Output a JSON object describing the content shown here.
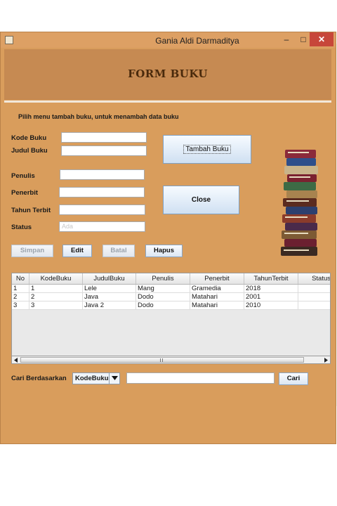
{
  "window": {
    "title": "Gania Aldi Darmaditya",
    "minimize_glyph": "–",
    "maximize_glyph": "□",
    "close_glyph": "✕"
  },
  "header": {
    "title": "FORM BUKU"
  },
  "instruction": "Pilih menu tambah buku, untuk menambah data buku",
  "form": {
    "kode_label": "Kode Buku",
    "judul_label": "Judul Buku",
    "penulis_label": "Penulis",
    "penerbit_label": "Penerbit",
    "tahun_label": "Tahun Terbit",
    "status_label": "Status",
    "kode_value": "",
    "judul_value": "",
    "penulis_value": "",
    "penerbit_value": "",
    "tahun_value": "",
    "status_placeholder": "Ada"
  },
  "buttons": {
    "tambah": "Tambah Buku",
    "close": "Close",
    "simpan": "Simpan",
    "edit": "Edit",
    "batal": "Batal",
    "hapus": "Hapus",
    "cari": "Cari"
  },
  "table": {
    "columns": [
      "No",
      "KodeBuku",
      "JudulBuku",
      "Penulis",
      "Penerbit",
      "TahunTerbit",
      "Status"
    ],
    "rows": [
      [
        "1",
        "1",
        "Lele",
        "Mang",
        "Gramedia",
        "2018",
        ""
      ],
      [
        "2",
        "2",
        "Java",
        "Dodo",
        "Matahari",
        "2001",
        ""
      ],
      [
        "3",
        "3",
        "Java 2",
        "Dodo",
        "Matahari",
        "2010",
        ""
      ]
    ]
  },
  "search": {
    "label": "Cari Berdasarkan",
    "selected": "KodeBuku",
    "query": ""
  },
  "icons": {
    "app": "java-app-icon",
    "books": "book-stack-icon",
    "dropdown": "triangle-down-icon",
    "scroll_left": "scroll-left-icon",
    "scroll_right": "scroll-right-icon"
  },
  "colors": {
    "window_bg": "#d99d5c",
    "header_bg": "#c68a52",
    "title_text": "#4a2a0c",
    "close_button": "#c7473a"
  }
}
